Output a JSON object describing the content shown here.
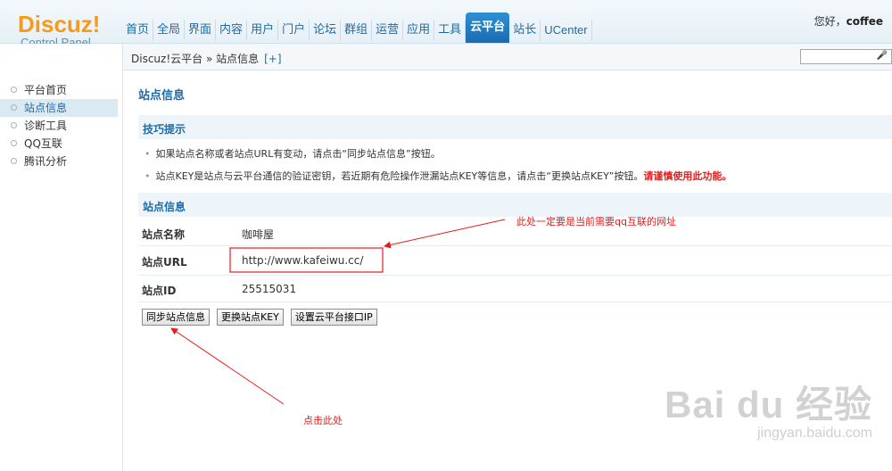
{
  "header": {
    "logo_main": "Discuz!",
    "logo_sub": "Control Panel",
    "nav": [
      "首页",
      "全局",
      "界面",
      "内容",
      "用户",
      "门户",
      "论坛",
      "群组",
      "运营",
      "应用",
      "工具",
      "云平台",
      "站长",
      "UCenter"
    ],
    "active_nav": "云平台",
    "greeting_prefix": "您好，",
    "greeting_user": "coffee"
  },
  "breadcrumb": {
    "text": "Discuz!云平台 » 站点信息",
    "plus": "[+]"
  },
  "sidebar": {
    "items": [
      "平台首页",
      "站点信息",
      "诊断工具",
      "QQ互联",
      "腾讯分析"
    ],
    "active": "站点信息"
  },
  "main": {
    "title": "站点信息",
    "tips_title": "技巧提示",
    "tip1": "如果站点名称或者站点URL有变动，请点击“同步站点信息”按钮。",
    "tip2": "站点KEY是站点与云平台通信的验证密钥，若近期有危险操作泄漏站点KEY等信息，请点击“更换站点KEY”按钮。",
    "tip2_warn": "请谨慎使用此功能。",
    "info_title": "站点信息",
    "rows": [
      {
        "label": "站点名称",
        "value": "咖啡屋"
      },
      {
        "label": "站点URL",
        "value": "http://www.kafeiwu.cc/"
      },
      {
        "label": "站点ID",
        "value": "25515031"
      }
    ],
    "buttons": [
      "同步站点信息",
      "更换站点KEY",
      "设置云平台接口IP"
    ]
  },
  "annotations": {
    "url_note": "此处一定要是当前需要qq互联的网址",
    "click_note": "点击此处"
  },
  "watermark": {
    "main": "Bai du 经验",
    "sub": "jingyan.baidu.com"
  },
  "colors": {
    "accent": "#1f6aa5",
    "annotation": "#e51d1d",
    "logo": "#f59a1e"
  }
}
